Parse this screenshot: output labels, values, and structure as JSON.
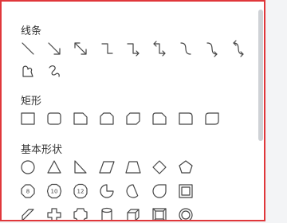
{
  "shapes_panel": {
    "sections": [
      {
        "title": "线条",
        "rows": [
          [
            "line-icon",
            "line-arrow-icon",
            "line-double-arrow-icon",
            "elbow-connector-icon",
            "elbow-arrow-connector-icon",
            "elbow-double-arrow-connector-icon",
            "curved-connector-icon",
            "curved-arrow-connector-icon",
            "curved-double-arrow-connector-icon"
          ],
          [
            "freeform-shape-icon",
            "scribble-icon"
          ]
        ]
      },
      {
        "title": "矩形",
        "rows": [
          [
            "rectangle-icon",
            "rounded-rectangle-icon",
            "snip-single-corner-rectangle-icon",
            "snip-same-side-rectangle-icon",
            "snip-diagonal-rectangle-icon",
            "snip-round-rectangle-icon",
            "round-single-corner-rectangle-icon",
            "round-diagonal-rectangle-icon"
          ]
        ]
      },
      {
        "title": "基本形状",
        "rows": [
          [
            "oval-icon",
            "triangle-icon",
            "right-triangle-icon",
            "parallelogram-icon",
            "trapezoid-icon",
            "diamond-icon",
            "pentagon-icon"
          ],
          [
            "octagon-icon",
            "decagon-icon",
            "dodecagon-icon",
            "pie-icon",
            "chord-icon",
            "teardrop-icon",
            "frame-icon"
          ],
          [
            "diagonal-stripe-icon",
            "plus-icon",
            "plaque-icon",
            "can-icon",
            "cube-icon",
            "bevel-icon",
            "donut-icon"
          ]
        ]
      }
    ],
    "polygon_labels": {
      "octagon": "8",
      "decagon": "10",
      "dodecagon": "12"
    }
  }
}
